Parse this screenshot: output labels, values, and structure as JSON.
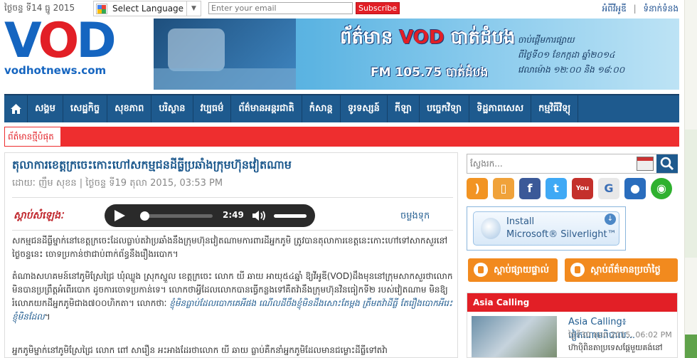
{
  "topbar": {
    "date": "ថ្ងៃចន្ទ ទី14 ធ្នូ 2015",
    "language_label": "Select Language",
    "email_placeholder": "Enter your email",
    "subscribe_label": "Subscribe",
    "links": [
      "អំពីវីអូឌី",
      "ទំនាក់ទំនង"
    ]
  },
  "logo": {
    "v": "V",
    "o": "O",
    "d": "D",
    "site": "vodhotnews.com"
  },
  "banner": {
    "title_left": "ព័ត៌មាន",
    "title_brand": "VOD",
    "title_right": "បាត់ដំបង",
    "freq": "FM 105.75 បាត់ដំបង",
    "schedule": [
      "ចាប់ផ្តើមការផ្សាយ",
      "ពីថ្ងៃទី០១ ខែកក្កដា ឆ្នាំ២០១៤",
      "វេលាម៉ោង ១២:០០ និង ១៨:០០"
    ]
  },
  "nav": {
    "items": [
      "សង្គម",
      "សេដ្ឋកិច្ច",
      "សុខភាព",
      "បរិស្ថាន",
      "វប្បធម៌",
      "ព័ត៌មានអន្តរជាតិ",
      "កំសាន្ត",
      "ទូរទស្សន៍",
      "កីឡា",
      "បច្ចេកវិទ្យា",
      "ទិដ្ឋភាពសេស",
      "កម្មវិធីវិទ្យុ"
    ]
  },
  "breaking": {
    "label": "ព័ត៌មានថ្មីបំផុត"
  },
  "article": {
    "title": "តុលាការខេត្តក្រចេះកោះហៅសកម្មជនដីធ្លីប្រឆាំងក្រុមហ៊ុនវៀតណាម",
    "byline": "ដោយៈ ញឹម សុខន | ថ្ងៃចន្ទ ទី19 តុលា 2015, 03:53 PM",
    "listen_label": "ស្តាប់សំឡេងៈ",
    "player_time": "2:49",
    "download_label": "ចម្លងទុក",
    "para1": "សកម្មជនដីធ្លីម្នាក់នៅខេត្តក្រចេះដែលធ្លាប់តវ៉ាប្រឆាំងនឹងក្រុមហ៊ុនវៀតណាមការពារដីអ្នកភូមិ ត្រូវបានតុលាការខេត្តនេះកោះហៅទៅសាកសួរនៅថ្ងៃចន្ទនេះ ចោទប្រកាន់ថាជាប់ពាក់ព័ន្ធនឹងរឿងរបោក។",
    "para2": "តំណាងសហគមន៍នៅភូមិស្រែជ្រៃ ឃុំឈ្លូង ស្រុកស្នួល ខេត្តក្រចេះ លោក យី ឆាយ អាយុ៥៤ឆ្នាំ ឱ្យវីអូឌី(VOD)ដឹងមុននៅក្រុមសាកសួរថាលោកមិនបានប្រព្រឹត្តអំពើរបោក ដូចការចោទប្រកាន់ទេ។ លោកថាអ្វីដែលលោកបានធ្វើកន្លងទៅគឺតវ៉ានឹងក្រុមហ៊ុនវិនធៀកទី២ របស់វៀតណាម មិនឱ្យរំលោភយកដីអ្នកភូមិជាង៧០០ហិកតា។ លោកថាៈ",
    "para2_quote": "ខ្ញុំមិនធ្លាប់ដែលបោកគេអីផង ណើលដីចឹងខ្ញុំមិនដឹងសោះតែម្តង ត្រឹមតវ៉ាដីធ្លី តែរឿងបោកអីរេះ ខ្ញុំមិនដែល",
    "para2_end": "។",
    "para3": "អ្នកភូមិម្នាក់នៅភូមិស្រែជ្រៃ លោក ពៅ សារឿន អះអាងដែរថាលោក យី ឆាយ ធ្លាប់គឺកនាំអ្នកភូមិដែលមានជម្លោះដីធ្លីទៅតវ៉ា"
  },
  "sidebar": {
    "search_placeholder": "ស្វែងរក...",
    "social_icons": [
      "rss-icon",
      "mobile-icon",
      "facebook-icon",
      "twitter-icon",
      "youtube-icon",
      "google-icon",
      "myspace-icon",
      "line-icon"
    ],
    "silverlight": {
      "line1": "Install",
      "line2": "Microsoft® Silverlight™"
    },
    "listen_live": "ស្តាប់ផ្សាយផ្ទាល់",
    "listen_daily": "ស្តាប់ព័ត៌មានប្រចាំថ្ងៃ",
    "asia": {
      "header": "Asia Calling",
      "item_title": "Asia Calling៖ វៀតណាមពិបាល...",
      "item_date": "ថ្ងៃទី30 តុលា 2015, 06:02 PM",
      "item_text": "ហ៊ាប៉ិពិនតាប្រទេសផ្តែមួយគង់នៅ"
    }
  },
  "colors": {
    "nav_blue": "#1e5a8e",
    "brand_red": "#e21f26",
    "listen_orange": "#f28a1e"
  }
}
